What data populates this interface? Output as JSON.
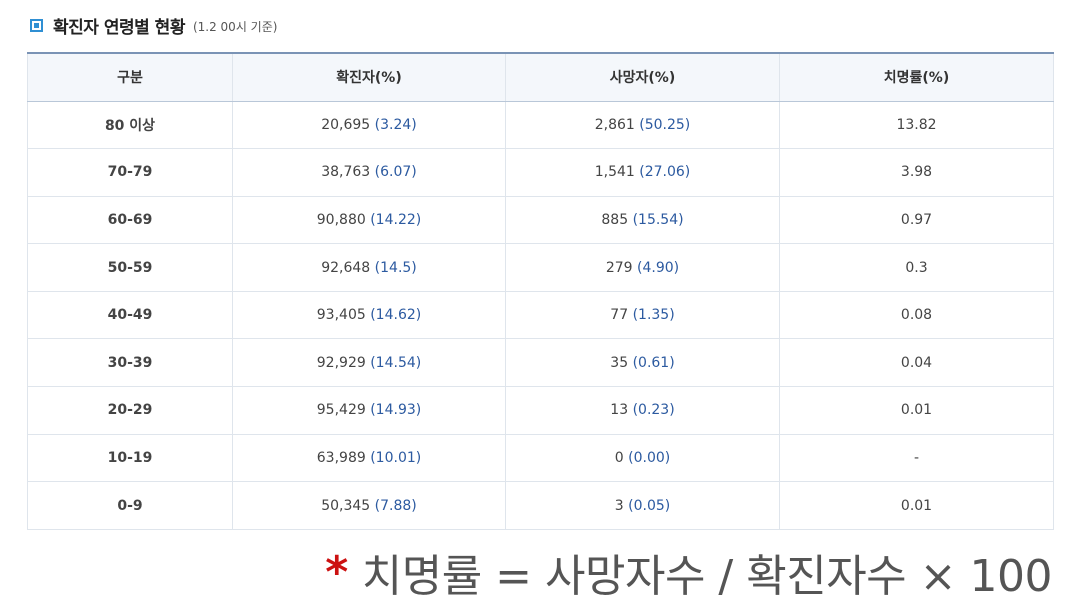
{
  "header": {
    "title": "확진자 연령별 현황",
    "subtitle": "(1.2 00시 기준)"
  },
  "table": {
    "columns": [
      "구분",
      "확진자(%)",
      "사망자(%)",
      "치명률(%)"
    ],
    "rows": [
      {
        "group": "80 이상",
        "confirmed": "20,695",
        "confirmed_pct": "(3.24)",
        "deaths": "2,861",
        "deaths_pct": "(50.25)",
        "rate": "13.82"
      },
      {
        "group": "70-79",
        "confirmed": "38,763",
        "confirmed_pct": "(6.07)",
        "deaths": "1,541",
        "deaths_pct": "(27.06)",
        "rate": "3.98"
      },
      {
        "group": "60-69",
        "confirmed": "90,880",
        "confirmed_pct": "(14.22)",
        "deaths": "885",
        "deaths_pct": "(15.54)",
        "rate": "0.97"
      },
      {
        "group": "50-59",
        "confirmed": "92,648",
        "confirmed_pct": "(14.5)",
        "deaths": "279",
        "deaths_pct": "(4.90)",
        "rate": "0.3"
      },
      {
        "group": "40-49",
        "confirmed": "93,405",
        "confirmed_pct": "(14.62)",
        "deaths": "77",
        "deaths_pct": "(1.35)",
        "rate": "0.08"
      },
      {
        "group": "30-39",
        "confirmed": "92,929",
        "confirmed_pct": "(14.54)",
        "deaths": "35",
        "deaths_pct": "(0.61)",
        "rate": "0.04"
      },
      {
        "group": "20-29",
        "confirmed": "95,429",
        "confirmed_pct": "(14.93)",
        "deaths": "13",
        "deaths_pct": "(0.23)",
        "rate": "0.01"
      },
      {
        "group": "10-19",
        "confirmed": "63,989",
        "confirmed_pct": "(10.01)",
        "deaths": "0",
        "deaths_pct": "(0.00)",
        "rate": "-"
      },
      {
        "group": "0-9",
        "confirmed": "50,345",
        "confirmed_pct": "(7.88)",
        "deaths": "3",
        "deaths_pct": "(0.05)",
        "rate": "0.01"
      }
    ]
  },
  "footnote": {
    "marker": "*",
    "text": "치명률 = 사망자수 / 확진자수 × 100"
  },
  "colors": {
    "accent": "#2f8fd3",
    "value_blue": "#2c5aa0",
    "marker_red": "#cc1111"
  }
}
